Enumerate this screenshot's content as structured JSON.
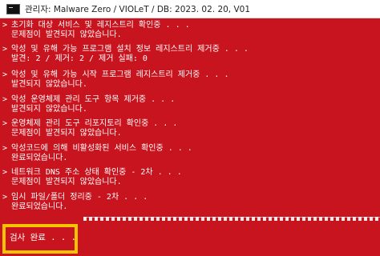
{
  "window": {
    "title": "관리자:  Malware Zero / VIOLeT / DB: 2023. 02. 20, V01",
    "icon": "console-icon"
  },
  "entries": [
    {
      "lines": [
        "초기화 대상 서비스 및 레지스트리 확인중 . . .",
        "문제점이 발견되지 않았습니다."
      ]
    },
    {
      "lines": [
        "악성 및 유해 가능 프로그램 설치 정보 레지스트리 제거중 . . .",
        "발견: 2 / 제거: 2 / 제거 실패: 0"
      ]
    },
    {
      "lines": [
        "악성 및 유해 가능 시작 프로그램 레지스트리 제거중 . . .",
        "발견되지 않았습니다."
      ]
    },
    {
      "lines": [
        "악성 운영체제 관리 도구 항목 제거중 . . .",
        "발견되지 않았습니다."
      ]
    },
    {
      "lines": [
        "운영체제 관리 도구 리포지토리 확인중 . . .",
        "문제점이 발견되지 않았습니다."
      ]
    },
    {
      "lines": [
        "악성코드에 의해 비활성화된 서비스 확인중 . . .",
        "완료되었습니다."
      ]
    },
    {
      "lines": [
        "네트워크 DNS 주소 상태 확인중 - 2차 . . .",
        "문제점이 발견되지 않았습니다."
      ]
    },
    {
      "lines": [
        "임시 파일/폴더 정리중 - 2차 . . .",
        "완료되었습니다."
      ]
    }
  ],
  "prompt_glyph": ">",
  "final_message": "검사 완료 . . .",
  "colors": {
    "console_background": "#c8141e",
    "console_text": "#ffffff",
    "highlight_border": "#f5c400"
  }
}
